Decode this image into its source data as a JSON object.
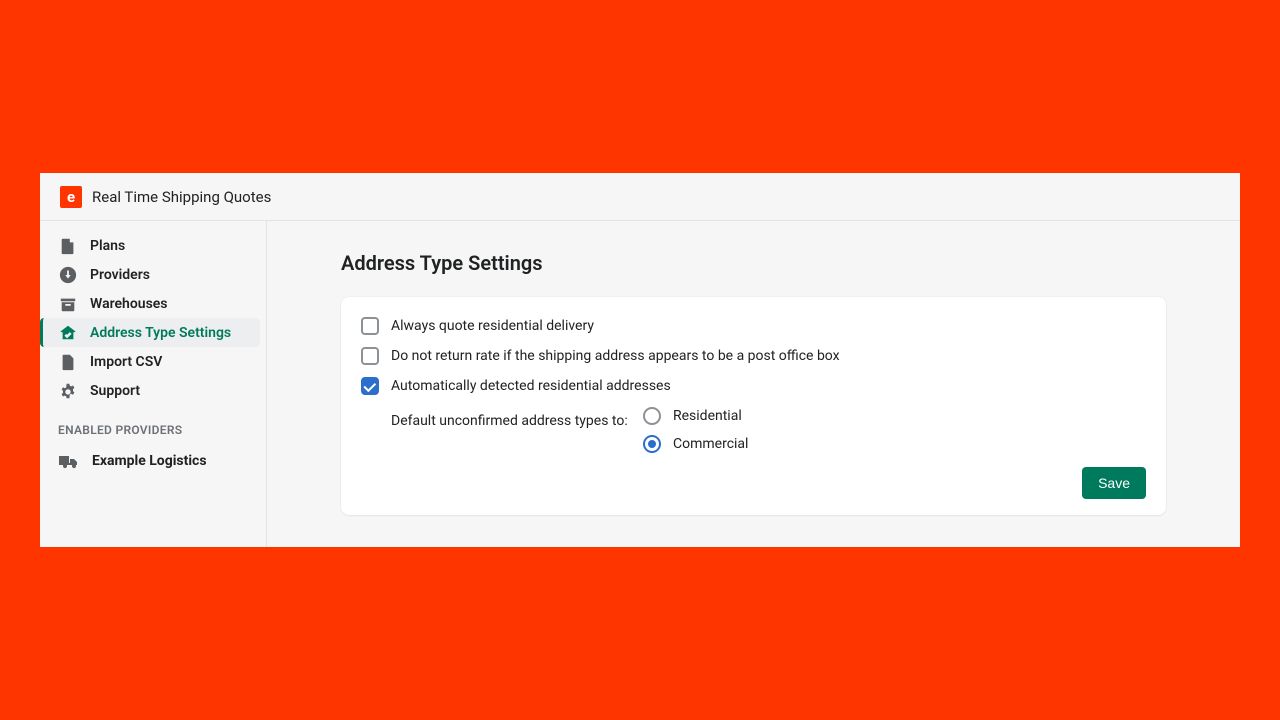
{
  "header": {
    "logo_letter": "e",
    "title": "Real Time Shipping Quotes"
  },
  "sidebar": {
    "items": [
      {
        "label": "Plans",
        "icon": "file-info-icon",
        "active": false
      },
      {
        "label": "Providers",
        "icon": "download-circle-icon",
        "active": false
      },
      {
        "label": "Warehouses",
        "icon": "archive-icon",
        "active": false
      },
      {
        "label": "Address Type Settings",
        "icon": "home-check-icon",
        "active": true
      },
      {
        "label": "Import CSV",
        "icon": "file-lines-icon",
        "active": false
      },
      {
        "label": "Support",
        "icon": "gear-icon",
        "active": false
      }
    ],
    "section_label": "ENABLED PROVIDERS",
    "providers": [
      {
        "label": "Example Logistics",
        "icon": "truck-icon"
      }
    ]
  },
  "main": {
    "page_title": "Address Type Settings",
    "checkboxes": [
      {
        "label": "Always quote residential delivery",
        "checked": false
      },
      {
        "label": "Do not return rate if the shipping address appears to be a post office box",
        "checked": false
      },
      {
        "label": "Automatically detected residential addresses",
        "checked": true
      }
    ],
    "default_group": {
      "label": "Default unconfirmed address types to:",
      "options": [
        {
          "label": "Residential",
          "selected": false
        },
        {
          "label": "Commercial",
          "selected": true
        }
      ]
    },
    "save_label": "Save"
  }
}
